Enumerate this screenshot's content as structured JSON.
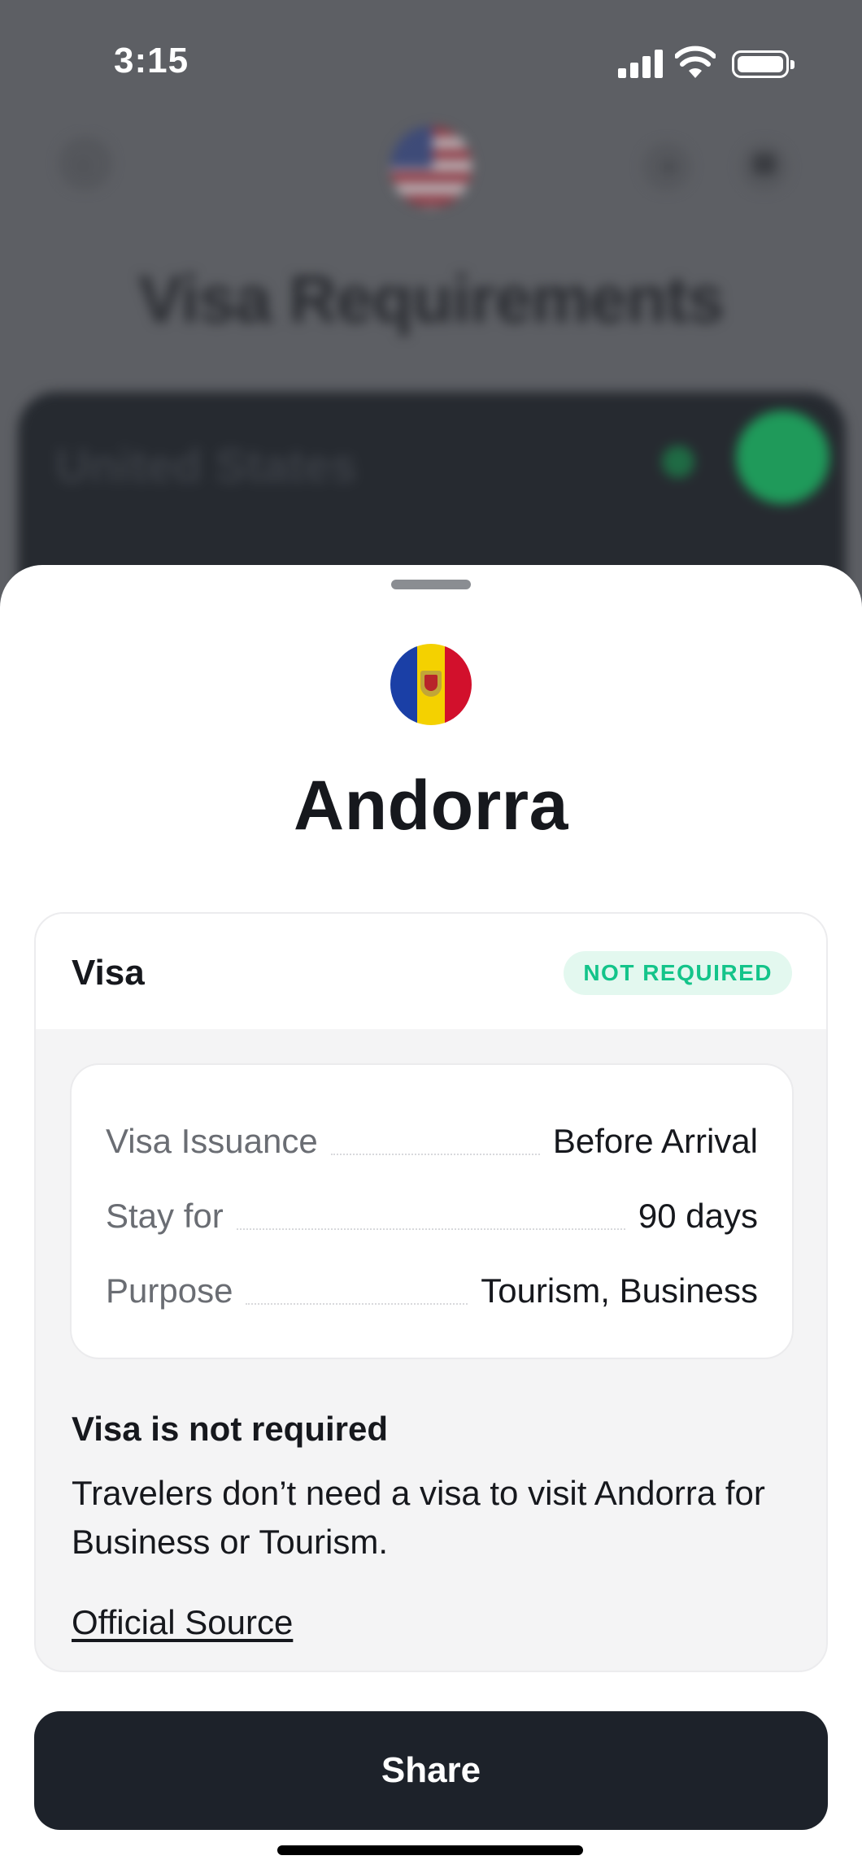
{
  "status_bar": {
    "time": "3:15"
  },
  "background": {
    "title": "Visa Requirements",
    "card_title": "United States",
    "back_icon": "chevron-left-icon",
    "plus_icon": "plus-icon",
    "share_icon": "share-icon"
  },
  "sheet": {
    "country": "Andorra",
    "flag_colors": [
      "#1a3fa6",
      "#f4d100",
      "#d2102c"
    ],
    "visa": {
      "label": "Visa",
      "status": "NOT REQUIRED",
      "status_color": "#14c48a",
      "details": [
        {
          "key": "Visa Issuance",
          "value": "Before Arrival"
        },
        {
          "key": "Stay for",
          "value": "90 days"
        },
        {
          "key": "Purpose",
          "value": "Tourism, Business"
        }
      ],
      "info_title": "Visa is not required",
      "info_text": "Travelers don’t need a visa to visit Andorra for Business or Tourism.",
      "source_link": "Official Source"
    },
    "share_label": "Share"
  }
}
